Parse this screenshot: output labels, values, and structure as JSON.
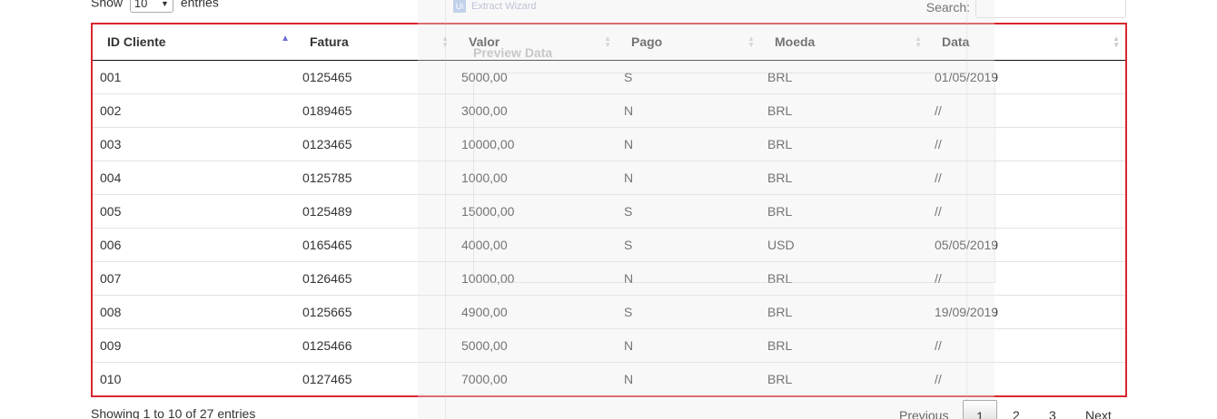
{
  "length_control": {
    "prefix": "Show",
    "value": "10",
    "suffix": "entries"
  },
  "search": {
    "label": "Search:",
    "value": ""
  },
  "overlay": {
    "wizard_logo": "Ui",
    "wizard_title": "Extract Wizard",
    "preview_title": "Preview Data"
  },
  "table": {
    "headers": [
      "ID Cliente",
      "Fatura",
      "Valor",
      "Pago",
      "Moeda",
      "Data"
    ],
    "rows": [
      [
        "001",
        "0125465",
        "5000,00",
        "S",
        "BRL",
        "01/05/2019"
      ],
      [
        "002",
        "0189465",
        "3000,00",
        "N",
        "BRL",
        "//"
      ],
      [
        "003",
        "0123465",
        "10000,00",
        "N",
        "BRL",
        "//"
      ],
      [
        "004",
        "0125785",
        "1000,00",
        "N",
        "BRL",
        "//"
      ],
      [
        "005",
        "0125489",
        "15000,00",
        "S",
        "BRL",
        "//"
      ],
      [
        "006",
        "0165465",
        "4000,00",
        "S",
        "USD",
        "05/05/2019"
      ],
      [
        "007",
        "0126465",
        "10000,00",
        "N",
        "BRL",
        "//"
      ],
      [
        "008",
        "0125665",
        "4900,00",
        "S",
        "BRL",
        "19/09/2019"
      ],
      [
        "009",
        "0125466",
        "5000,00",
        "N",
        "BRL",
        "//"
      ],
      [
        "010",
        "0127465",
        "7000,00",
        "N",
        "BRL",
        "//"
      ]
    ]
  },
  "footer": {
    "info": "Showing 1 to 10 of 27 entries"
  },
  "pagination": {
    "previous": "Previous",
    "pages": [
      "1",
      "2",
      "3"
    ],
    "current": "1",
    "next": "Next"
  }
}
